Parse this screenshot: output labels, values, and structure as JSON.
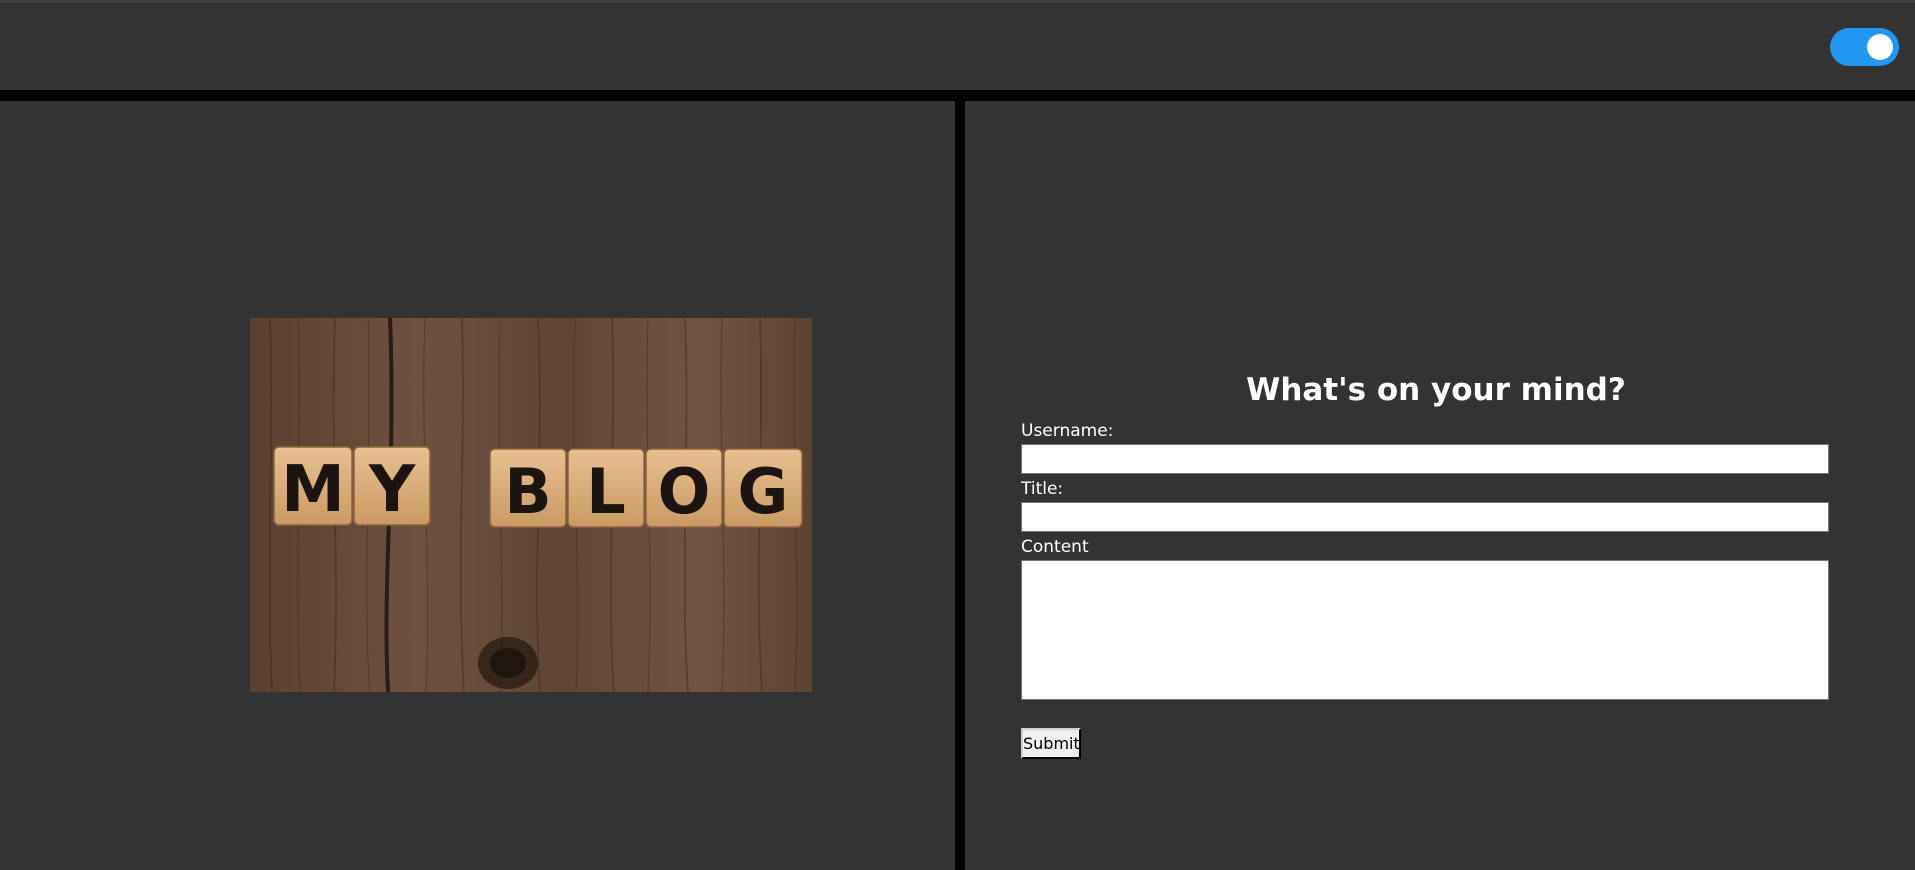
{
  "header": {
    "theme_toggle": {
      "state": "on",
      "color": "#2196f3"
    }
  },
  "blog_image": {
    "tiles_word1": [
      "M",
      "Y"
    ],
    "tiles_word2": [
      "B",
      "L",
      "O",
      "G"
    ]
  },
  "form": {
    "heading": "What's on your mind?",
    "username_label": "Username:",
    "username_value": "",
    "title_label": "Title:",
    "title_value": "",
    "content_label": "Content",
    "content_value": "",
    "submit_label": "Submit"
  },
  "colors": {
    "panel_bg": "#333333",
    "divider": "#000000",
    "toggle_accent": "#2196f3"
  }
}
